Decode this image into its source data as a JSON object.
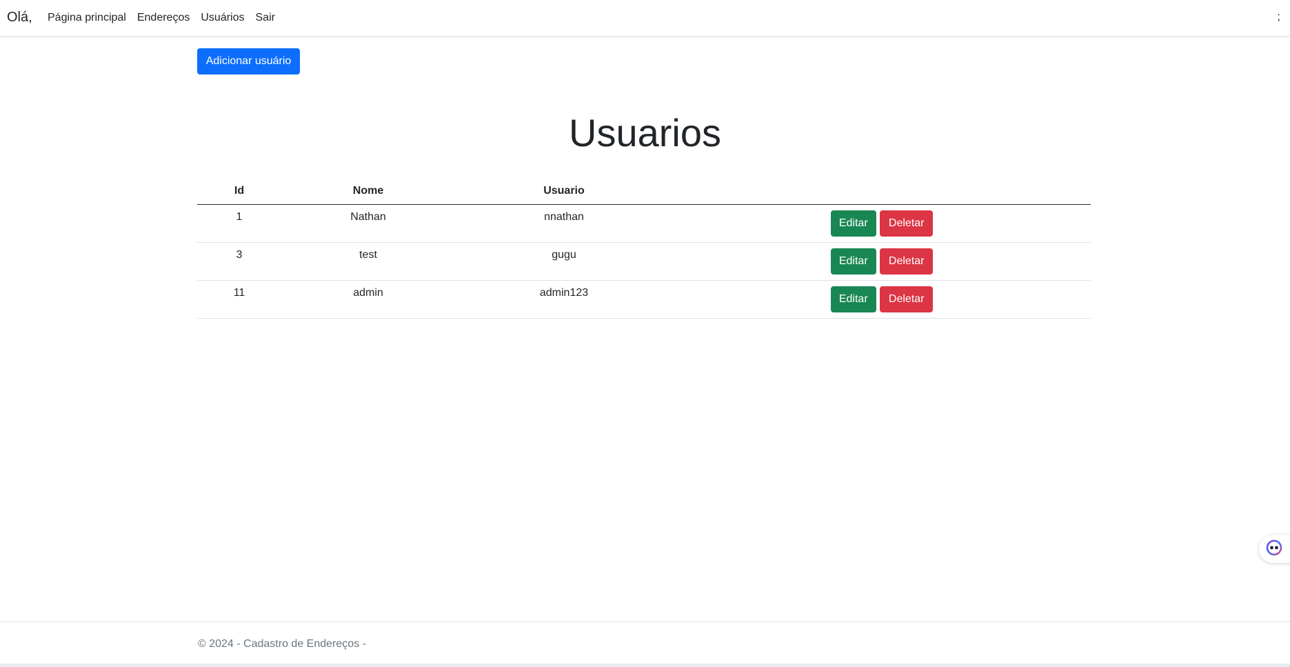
{
  "navbar": {
    "brand": "Olá,",
    "links": [
      "Página principal",
      "Endereços",
      "Usuários",
      "Sair"
    ],
    "right_text": ";"
  },
  "actions": {
    "add_user_label": "Adicionar usuário"
  },
  "main": {
    "title": "Usuarios"
  },
  "table": {
    "headers": [
      "Id",
      "Nome",
      "Usuario",
      ""
    ],
    "rows": [
      {
        "id": "1",
        "nome": "Nathan",
        "usuario": "nnathan"
      },
      {
        "id": "3",
        "nome": "test",
        "usuario": "gugu"
      },
      {
        "id": "11",
        "nome": "admin",
        "usuario": "admin123"
      }
    ],
    "edit_label": "Editar",
    "delete_label": "Deletar"
  },
  "footer": {
    "text": "© 2024 - Cadastro de Endereços -"
  },
  "colors": {
    "primary": "#0d6efd",
    "success": "#198754",
    "danger": "#dc3545",
    "footer_text": "#6c757d"
  },
  "icons": {
    "floating_assistant": "assistant-face-icon"
  }
}
